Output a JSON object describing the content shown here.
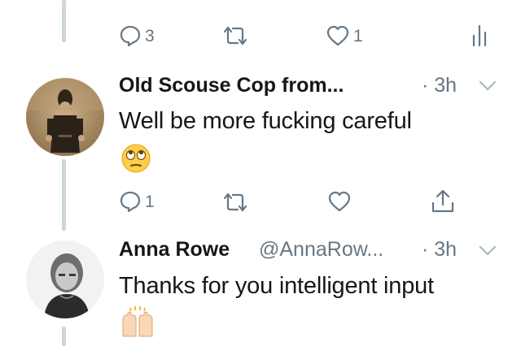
{
  "top_actions": {
    "reply_count": "3",
    "like_count": "1"
  },
  "tweets": [
    {
      "author": "Old Scouse Cop from...",
      "handle": "",
      "time": "· 3h",
      "text": "Well be more fucking careful",
      "emoji": "🙄",
      "reply_count": "1"
    },
    {
      "author": "Anna Rowe",
      "handle": "@AnnaRow...",
      "time": "· 3h",
      "text": "Thanks for you intelligent input",
      "emoji": "🙌🏻"
    }
  ],
  "colors": {
    "muted": "#657786",
    "thread_line": "#ccd6dd",
    "text": "#14171a"
  },
  "icons": [
    "reply-icon",
    "retweet-icon",
    "like-icon",
    "analytics-icon",
    "share-icon",
    "chevron-down-icon"
  ]
}
